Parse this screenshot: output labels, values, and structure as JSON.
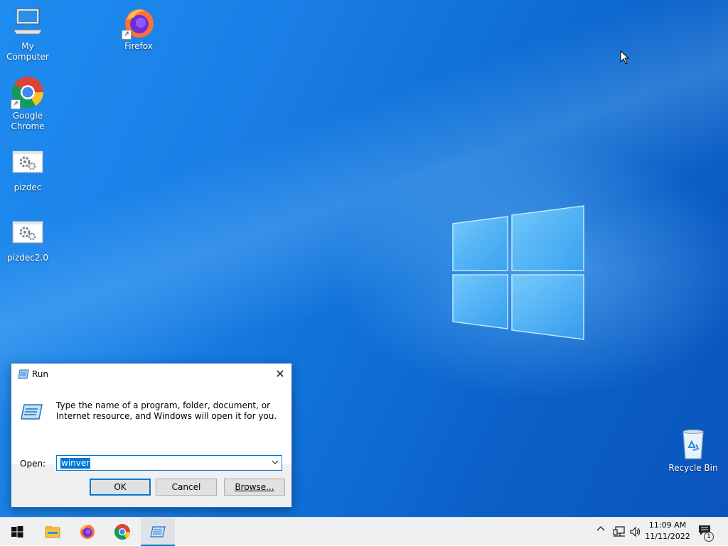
{
  "desktop": {
    "icons": [
      {
        "label": "My Computer"
      },
      {
        "label": "Firefox"
      },
      {
        "label": "Google Chrome"
      },
      {
        "label": "pizdec"
      },
      {
        "label": "pizdec2.0"
      },
      {
        "label": "Recycle Bin"
      }
    ]
  },
  "run_dialog": {
    "title": "Run",
    "close_glyph": "✕",
    "description": "Type the name of a program, folder, document, or Internet resource, and Windows will open it for you.",
    "open_label": "Open:",
    "input_value": "winver",
    "ok_label": "OK",
    "cancel_label": "Cancel",
    "browse_label": "Browse..."
  },
  "taskbar": {
    "buttons": [
      "start-icon",
      "file-explorer-icon",
      "firefox-icon",
      "chrome-icon",
      "run-icon"
    ],
    "active": "run-icon",
    "tray": {
      "chevron": "^",
      "time": "11:09 AM",
      "date": "11/11/2022",
      "notification_count": "1"
    }
  },
  "colors": {
    "accent": "#0078d7",
    "desktop_blue": "#1a7fe6",
    "taskbar_bg": "#eef0f2"
  }
}
